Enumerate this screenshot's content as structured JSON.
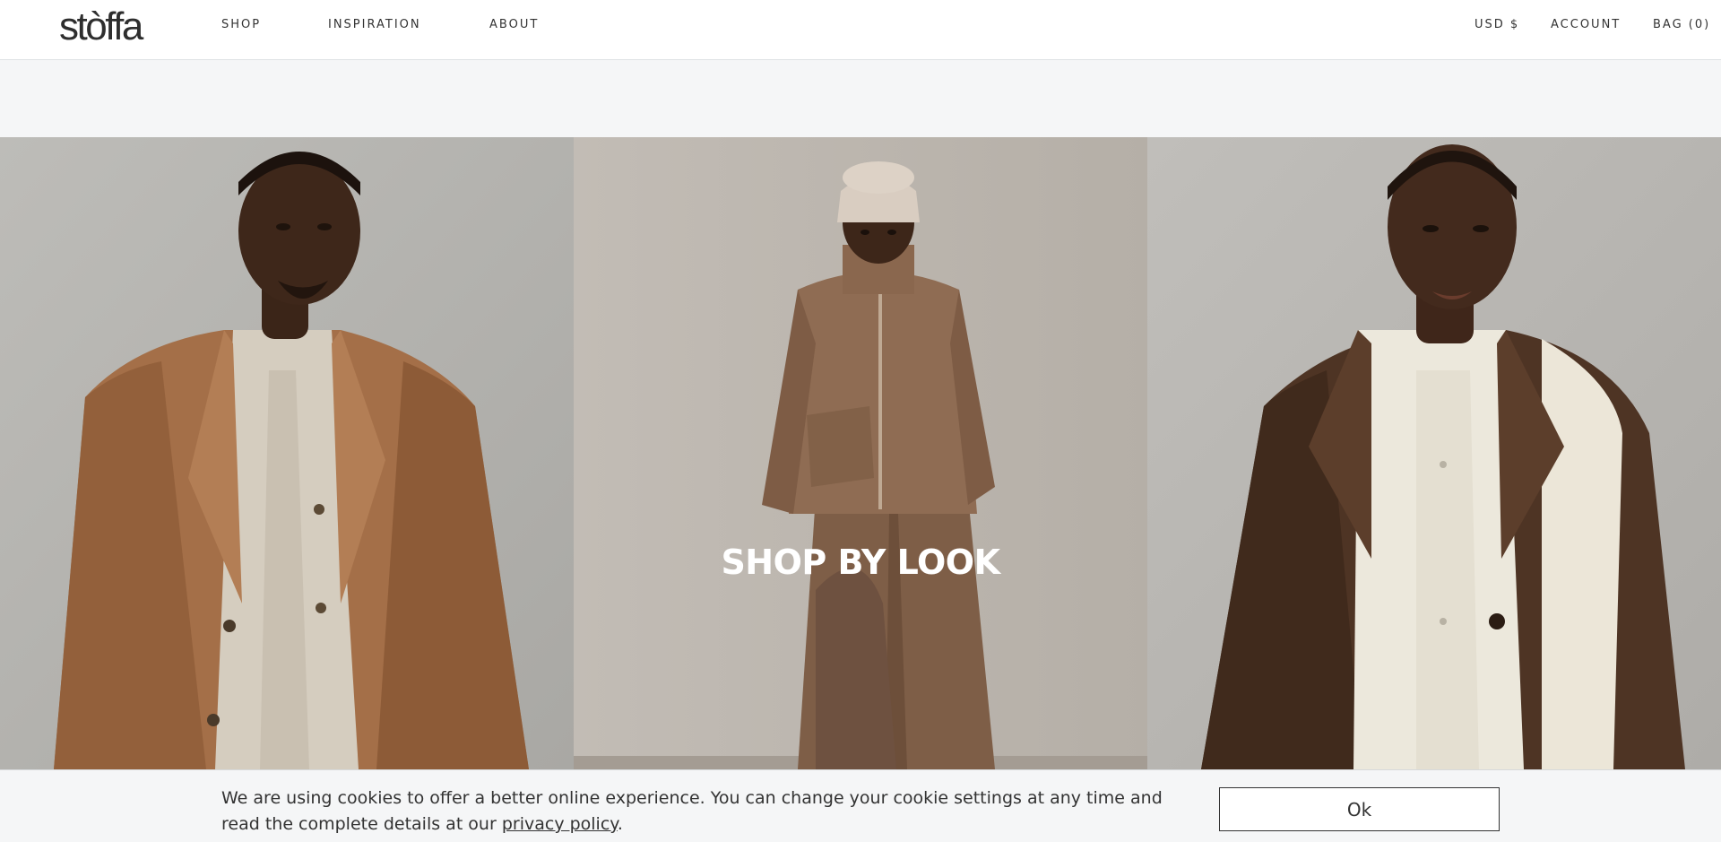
{
  "brand": {
    "logo_text": "stòffa"
  },
  "nav": {
    "shop": "SHOP",
    "inspiration": "INSPIRATION",
    "about": "ABOUT",
    "currency": "USD $",
    "account": "ACCOUNT",
    "bag": "BAG (0)"
  },
  "hero": {
    "title": "SHOP BY LOOK",
    "panels": [
      {
        "subject": "man in camel overcoat and cream cardigan"
      },
      {
        "subject": "man in beanie and brown zip jacket"
      },
      {
        "subject": "woman in dark brown coat and cream shirt"
      }
    ]
  },
  "cookie": {
    "text_before": "We are using cookies to offer a better online experience. You can change your cookie settings at any time and read the complete details at our ",
    "link_text": "privacy policy",
    "text_after": ".",
    "button_label": "Ok"
  },
  "colors": {
    "header_bg": "#ffffff",
    "band_bg": "#f5f6f7",
    "text": "#333333",
    "hero_title": "#ffffff"
  }
}
